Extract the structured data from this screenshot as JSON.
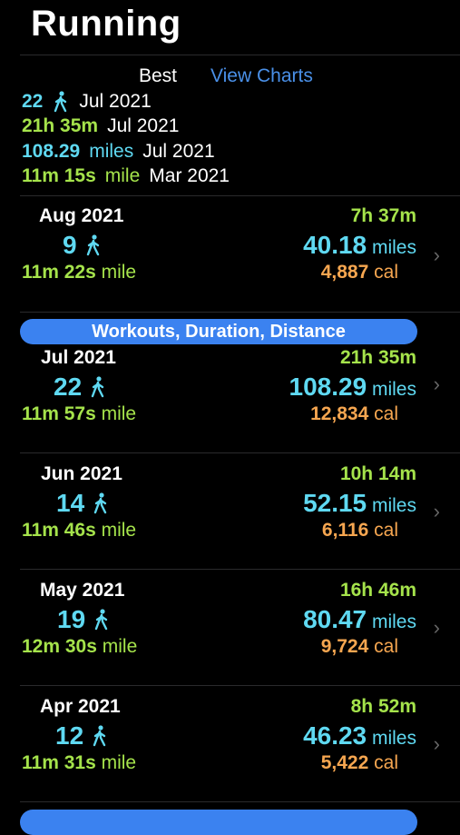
{
  "title": "Running",
  "best": {
    "label": "Best",
    "view_charts": "View Charts",
    "rows": [
      {
        "value": "22",
        "unit_icon": "walk-icon",
        "unit": "",
        "date": "Jul 2021",
        "color": "#5fd9f2"
      },
      {
        "value": "21h 35m",
        "unit": "",
        "date": "Jul 2021",
        "color": "#a5e34b"
      },
      {
        "value": "108.29",
        "unit": "miles",
        "date": "Jul 2021",
        "color": "#5fd9f2"
      },
      {
        "value": "11m 15s",
        "unit": "mile",
        "date": "Mar 2021",
        "color": "#a5e34b"
      }
    ]
  },
  "section_pill": "Workouts, Duration, Distance",
  "months": [
    {
      "name": "Aug 2021",
      "count": "9",
      "pace": "11m 22s",
      "pace_unit": "mile",
      "duration": "7h 37m",
      "distance": "40.18",
      "distance_unit": "miles",
      "calories": "4,887",
      "cal_unit": "cal"
    },
    {
      "name": "Jul 2021",
      "count": "22",
      "pace": "11m 57s",
      "pace_unit": "mile",
      "duration": "21h 35m",
      "distance": "108.29",
      "distance_unit": "miles",
      "calories": "12,834",
      "cal_unit": "cal"
    },
    {
      "name": "Jun 2021",
      "count": "14",
      "pace": "11m 46s",
      "pace_unit": "mile",
      "duration": "10h 14m",
      "distance": "52.15",
      "distance_unit": "miles",
      "calories": "6,116",
      "cal_unit": "cal"
    },
    {
      "name": "May 2021",
      "count": "19",
      "pace": "12m 30s",
      "pace_unit": "mile",
      "duration": "16h 46m",
      "distance": "80.47",
      "distance_unit": "miles",
      "calories": "9,724",
      "cal_unit": "cal"
    },
    {
      "name": "Apr 2021",
      "count": "12",
      "pace": "11m 31s",
      "pace_unit": "mile",
      "duration": "8h 52m",
      "distance": "46.23",
      "distance_unit": "miles",
      "calories": "5,422",
      "cal_unit": "cal"
    }
  ],
  "colors": {
    "cyan": "#5fd9f2",
    "green": "#a5e34b",
    "orange": "#f6a650",
    "accent": "#3b82f0",
    "link": "#4a90e8"
  }
}
